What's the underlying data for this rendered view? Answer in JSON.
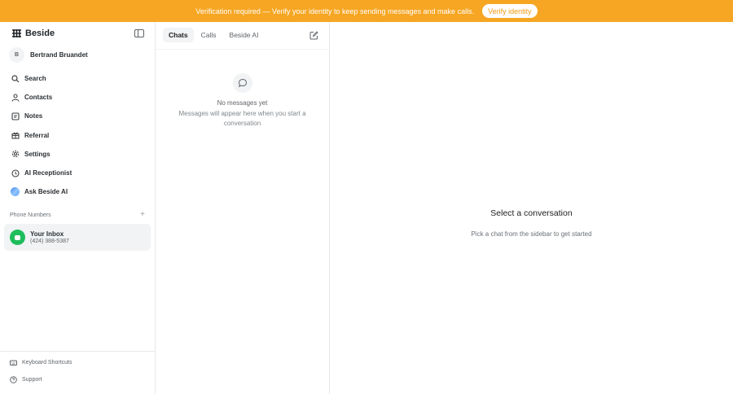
{
  "banner": {
    "message": "Verification required — Verify your identity to keep sending messages and make calls.",
    "button_label": "Verify identity"
  },
  "sidebar": {
    "brand": "Beside",
    "user": {
      "initial": "B",
      "name": "Bertrand Bruandet"
    },
    "nav": [
      {
        "label": "Search",
        "icon": "search-icon"
      },
      {
        "label": "Contacts",
        "icon": "user-icon"
      },
      {
        "label": "Notes",
        "icon": "note-icon"
      },
      {
        "label": "Referral",
        "icon": "gift-icon"
      },
      {
        "label": "Settings",
        "icon": "gear-icon"
      },
      {
        "label": "AI Receptionist",
        "icon": "receptionist-icon"
      },
      {
        "label": "Ask Beside AI",
        "icon": "ai-orb-icon"
      }
    ],
    "phone_numbers": {
      "heading": "Phone Numbers",
      "items": [
        {
          "name": "Your Inbox",
          "number": "(424) 388-5387"
        }
      ]
    },
    "bottom": [
      {
        "label": "Keyboard Shortcuts",
        "icon": "keyboard-icon"
      },
      {
        "label": "Support",
        "icon": "help-icon"
      }
    ]
  },
  "list": {
    "tabs": [
      {
        "label": "Chats",
        "active": true
      },
      {
        "label": "Calls",
        "active": false
      },
      {
        "label": "Beside AI",
        "active": false
      }
    ],
    "empty": {
      "title": "No messages yet",
      "subtitle": "Messages will appear here when you start a conversation"
    }
  },
  "main": {
    "title": "Select a conversation",
    "subtitle": "Pick a chat from the sidebar to get started"
  },
  "colors": {
    "banner": "#f6a623",
    "inbox_icon": "#1ebd5b"
  }
}
